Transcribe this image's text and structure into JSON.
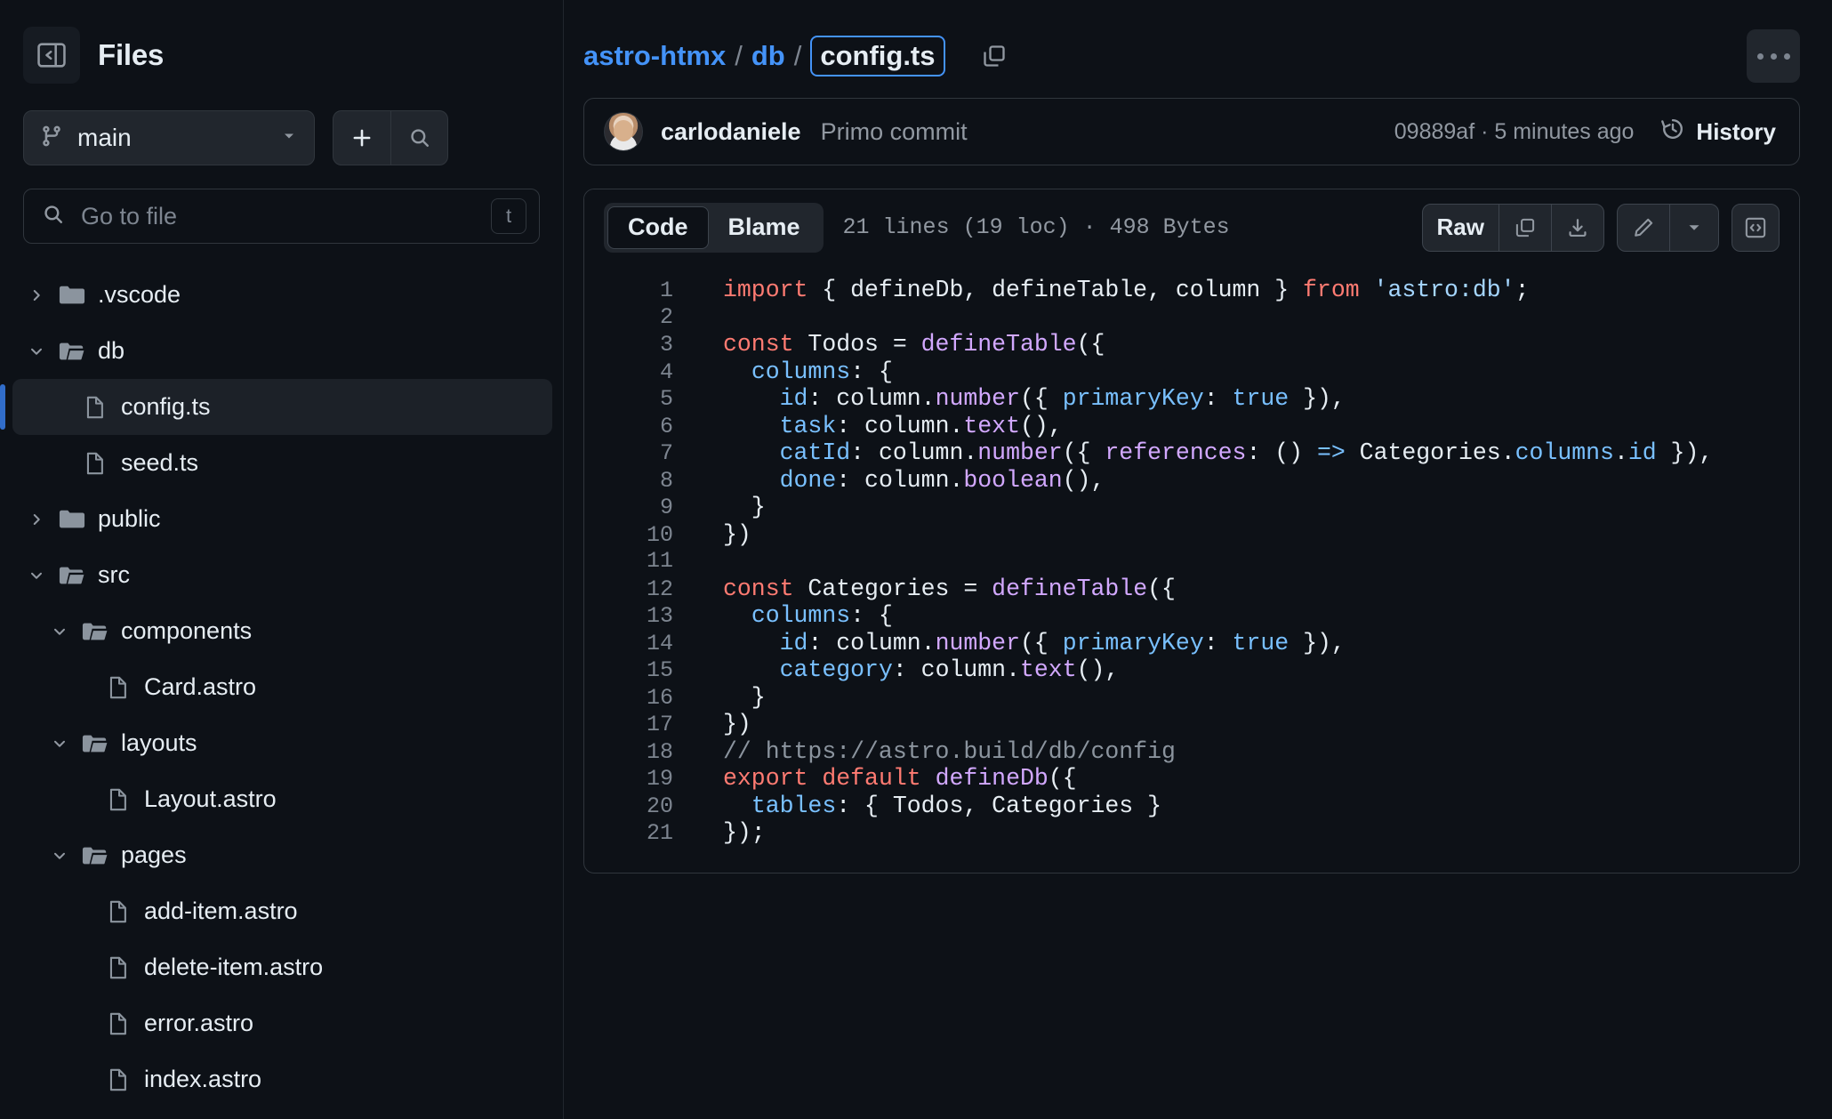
{
  "sidebar": {
    "panel_toggle_icon": "sidebar-collapse-icon",
    "title": "Files",
    "branch": {
      "icon": "git-branch-icon",
      "name": "main",
      "caret_icon": "chevron-down-icon"
    },
    "add_button_icon": "plus-icon",
    "search_button_icon": "search-icon",
    "go_to_file": {
      "icon": "search-icon",
      "placeholder": "Go to file",
      "shortcut": "t"
    },
    "tree": [
      {
        "label": ".vscode",
        "type": "folder",
        "state": "collapsed",
        "depth": 0,
        "selected": false
      },
      {
        "label": "db",
        "type": "folder",
        "state": "expanded",
        "depth": 0,
        "selected": false
      },
      {
        "label": "config.ts",
        "type": "file",
        "state": "",
        "depth": 1,
        "selected": true
      },
      {
        "label": "seed.ts",
        "type": "file",
        "state": "",
        "depth": 1,
        "selected": false
      },
      {
        "label": "public",
        "type": "folder",
        "state": "collapsed",
        "depth": 0,
        "selected": false
      },
      {
        "label": "src",
        "type": "folder",
        "state": "expanded",
        "depth": 0,
        "selected": false
      },
      {
        "label": "components",
        "type": "folder",
        "state": "expanded",
        "depth": 1,
        "selected": false
      },
      {
        "label": "Card.astro",
        "type": "file",
        "state": "",
        "depth": 2,
        "selected": false
      },
      {
        "label": "layouts",
        "type": "folder",
        "state": "expanded",
        "depth": 1,
        "selected": false
      },
      {
        "label": "Layout.astro",
        "type": "file",
        "state": "",
        "depth": 2,
        "selected": false
      },
      {
        "label": "pages",
        "type": "folder",
        "state": "expanded",
        "depth": 1,
        "selected": false
      },
      {
        "label": "add-item.astro",
        "type": "file",
        "state": "",
        "depth": 2,
        "selected": false
      },
      {
        "label": "delete-item.astro",
        "type": "file",
        "state": "",
        "depth": 2,
        "selected": false
      },
      {
        "label": "error.astro",
        "type": "file",
        "state": "",
        "depth": 2,
        "selected": false
      },
      {
        "label": "index.astro",
        "type": "file",
        "state": "",
        "depth": 2,
        "selected": false
      }
    ]
  },
  "header": {
    "breadcrumb": {
      "repo": "astro-htmx",
      "separator": "/",
      "folder": "db",
      "file": "config.ts"
    },
    "copy_path_icon": "copy-icon",
    "more_options_icon": "kebab-icon"
  },
  "commit": {
    "author": "carlodaniele",
    "message": "Primo commit",
    "meta": "09889af · 5 minutes ago",
    "history_label": "History",
    "history_icon": "history-clock-icon"
  },
  "code_toolbar": {
    "tabs": [
      {
        "label": "Code",
        "active": true
      },
      {
        "label": "Blame",
        "active": false
      }
    ],
    "lines_info": "21 lines (19 loc) · 498 Bytes",
    "raw_label": "Raw",
    "copy_icon": "copy-icon",
    "download_icon": "download-icon",
    "edit_icon": "pencil-icon",
    "edit_caret_icon": "chevron-down-icon",
    "symbols_icon": "code-brackets-icon"
  },
  "colors": {
    "accent_blue": "#4493f8",
    "keyword": "#ff7b72",
    "function": "#d2a8ff",
    "property": "#79c0ff",
    "string": "#a5d6ff",
    "comment": "#8b949e",
    "text": "#e6edf3",
    "background": "#0d1117",
    "selection_bar": "#316dca"
  },
  "code": {
    "language": "typescript",
    "file_name": "config.ts",
    "lines": [
      {
        "n": 1,
        "tokens": [
          {
            "t": "import",
            "c": "k"
          },
          {
            "t": " { defineDb, defineTable, column } ",
            "c": "pl"
          },
          {
            "t": "from",
            "c": "k"
          },
          {
            "t": " ",
            "c": "pl"
          },
          {
            "t": "'astro:db'",
            "c": "st"
          },
          {
            "t": ";",
            "c": "pl"
          }
        ]
      },
      {
        "n": 2,
        "tokens": []
      },
      {
        "n": 3,
        "tokens": [
          {
            "t": "const",
            "c": "k"
          },
          {
            "t": " Todos ",
            "c": "pl"
          },
          {
            "t": "=",
            "c": "pl"
          },
          {
            "t": " ",
            "c": "pl"
          },
          {
            "t": "defineTable",
            "c": "fn"
          },
          {
            "t": "({",
            "c": "pl"
          }
        ]
      },
      {
        "n": 4,
        "tokens": [
          {
            "t": "  ",
            "c": "pl"
          },
          {
            "t": "columns",
            "c": "pr"
          },
          {
            "t": ": {",
            "c": "pl"
          }
        ]
      },
      {
        "n": 5,
        "tokens": [
          {
            "t": "    ",
            "c": "pl"
          },
          {
            "t": "id",
            "c": "pr"
          },
          {
            "t": ": column.",
            "c": "pl"
          },
          {
            "t": "number",
            "c": "fn"
          },
          {
            "t": "({ ",
            "c": "pl"
          },
          {
            "t": "primaryKey",
            "c": "pr"
          },
          {
            "t": ": ",
            "c": "pl"
          },
          {
            "t": "true",
            "c": "pr"
          },
          {
            "t": " }),",
            "c": "pl"
          }
        ]
      },
      {
        "n": 6,
        "tokens": [
          {
            "t": "    ",
            "c": "pl"
          },
          {
            "t": "task",
            "c": "pr"
          },
          {
            "t": ": column.",
            "c": "pl"
          },
          {
            "t": "text",
            "c": "fn"
          },
          {
            "t": "(),",
            "c": "pl"
          }
        ]
      },
      {
        "n": 7,
        "tokens": [
          {
            "t": "    ",
            "c": "pl"
          },
          {
            "t": "catId",
            "c": "pr"
          },
          {
            "t": ": column.",
            "c": "pl"
          },
          {
            "t": "number",
            "c": "fn"
          },
          {
            "t": "({ ",
            "c": "pl"
          },
          {
            "t": "references",
            "c": "fn"
          },
          {
            "t": ": () ",
            "c": "pl"
          },
          {
            "t": "=>",
            "c": "op"
          },
          {
            "t": " Categories.",
            "c": "pl"
          },
          {
            "t": "columns",
            "c": "pr"
          },
          {
            "t": ".",
            "c": "pl"
          },
          {
            "t": "id",
            "c": "pr"
          },
          {
            "t": " }),",
            "c": "pl"
          }
        ]
      },
      {
        "n": 8,
        "tokens": [
          {
            "t": "    ",
            "c": "pl"
          },
          {
            "t": "done",
            "c": "pr"
          },
          {
            "t": ": column.",
            "c": "pl"
          },
          {
            "t": "boolean",
            "c": "fn"
          },
          {
            "t": "(),",
            "c": "pl"
          }
        ]
      },
      {
        "n": 9,
        "tokens": [
          {
            "t": "  }",
            "c": "pl"
          }
        ]
      },
      {
        "n": 10,
        "tokens": [
          {
            "t": "})",
            "c": "pl"
          }
        ]
      },
      {
        "n": 11,
        "tokens": []
      },
      {
        "n": 12,
        "tokens": [
          {
            "t": "const",
            "c": "k"
          },
          {
            "t": " Categories ",
            "c": "pl"
          },
          {
            "t": "=",
            "c": "pl"
          },
          {
            "t": " ",
            "c": "pl"
          },
          {
            "t": "defineTable",
            "c": "fn"
          },
          {
            "t": "({",
            "c": "pl"
          }
        ]
      },
      {
        "n": 13,
        "tokens": [
          {
            "t": "  ",
            "c": "pl"
          },
          {
            "t": "columns",
            "c": "pr"
          },
          {
            "t": ": {",
            "c": "pl"
          }
        ]
      },
      {
        "n": 14,
        "tokens": [
          {
            "t": "    ",
            "c": "pl"
          },
          {
            "t": "id",
            "c": "pr"
          },
          {
            "t": ": column.",
            "c": "pl"
          },
          {
            "t": "number",
            "c": "fn"
          },
          {
            "t": "({ ",
            "c": "pl"
          },
          {
            "t": "primaryKey",
            "c": "pr"
          },
          {
            "t": ": ",
            "c": "pl"
          },
          {
            "t": "true",
            "c": "pr"
          },
          {
            "t": " }),",
            "c": "pl"
          }
        ]
      },
      {
        "n": 15,
        "tokens": [
          {
            "t": "    ",
            "c": "pl"
          },
          {
            "t": "category",
            "c": "pr"
          },
          {
            "t": ": column.",
            "c": "pl"
          },
          {
            "t": "text",
            "c": "fn"
          },
          {
            "t": "(),",
            "c": "pl"
          }
        ]
      },
      {
        "n": 16,
        "tokens": [
          {
            "t": "  }",
            "c": "pl"
          }
        ]
      },
      {
        "n": 17,
        "tokens": [
          {
            "t": "})",
            "c": "pl"
          }
        ]
      },
      {
        "n": 18,
        "tokens": [
          {
            "t": "// https://astro.build/db/config",
            "c": "cm"
          }
        ]
      },
      {
        "n": 19,
        "tokens": [
          {
            "t": "export",
            "c": "k"
          },
          {
            "t": " ",
            "c": "pl"
          },
          {
            "t": "default",
            "c": "k"
          },
          {
            "t": " ",
            "c": "pl"
          },
          {
            "t": "defineDb",
            "c": "fn"
          },
          {
            "t": "({",
            "c": "pl"
          }
        ]
      },
      {
        "n": 20,
        "tokens": [
          {
            "t": "  ",
            "c": "pl"
          },
          {
            "t": "tables",
            "c": "pr"
          },
          {
            "t": ": { Todos, Categories }",
            "c": "pl"
          }
        ]
      },
      {
        "n": 21,
        "tokens": [
          {
            "t": "});",
            "c": "pl"
          }
        ]
      }
    ]
  }
}
